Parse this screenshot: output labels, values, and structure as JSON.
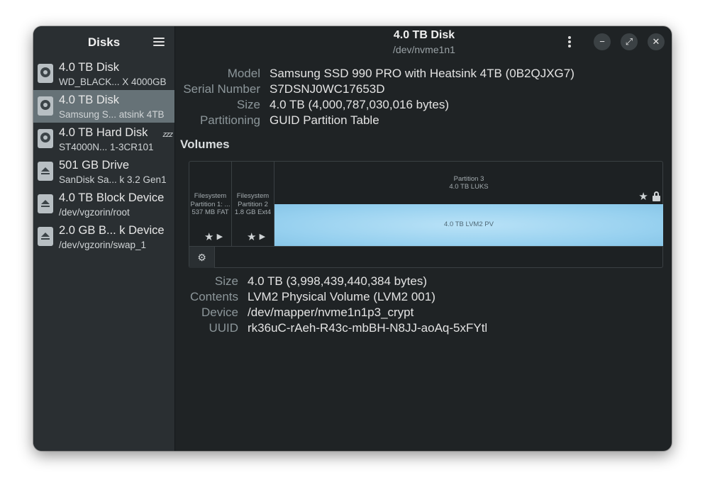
{
  "sidebar": {
    "title": "Disks",
    "items": [
      {
        "name": "4.0 TB Disk",
        "sub": "WD_BLACK... X 4000GB",
        "icon": "hard-disk-icon"
      },
      {
        "name": "4.0 TB Disk",
        "sub": "Samsung S... atsink 4TB",
        "icon": "hard-disk-icon",
        "selected": true
      },
      {
        "name": "4.0 TB Hard Disk",
        "sub": "ST4000N... 1-3CR101",
        "icon": "hard-disk-icon",
        "status": "zzz"
      },
      {
        "name": "501 GB Drive",
        "sub": "SanDisk Sa... k 3.2 Gen1",
        "icon": "removable-drive-icon"
      },
      {
        "name": "4.0 TB Block Device",
        "sub": "/dev/vgzorin/root",
        "icon": "removable-drive-icon"
      },
      {
        "name": "2.0 GB B... k Device",
        "sub": "/dev/vgzorin/swap_1",
        "icon": "removable-drive-icon"
      }
    ]
  },
  "header": {
    "title": "4.0 TB Disk",
    "subtitle": "/dev/nvme1n1",
    "minimize": "−",
    "maximize": "⤢",
    "close": "✕"
  },
  "drive": {
    "model_label": "Model",
    "model": "Samsung SSD 990 PRO with Heatsink 4TB (0B2QJXG7)",
    "serial_label": "Serial Number",
    "serial": "S7DSNJ0WC17653D",
    "size_label": "Size",
    "size": "4.0 TB (4,000,787,030,016 bytes)",
    "partitioning_label": "Partitioning",
    "partitioning": "GUID Partition Table"
  },
  "volumes": {
    "heading": "Volumes",
    "partitions": [
      {
        "line1": "Filesystem",
        "line2": "Partition 1: ...",
        "line3": "537 MB FAT"
      },
      {
        "line1": "Filesystem",
        "line2": "Partition 2",
        "line3": "1.8 GB Ext4"
      },
      {
        "line1": "Partition 3",
        "line2": "4.0 TB LUKS"
      }
    ],
    "lvm_label": "4.0 TB LVM2 PV",
    "icon_star": "★",
    "icon_play": "▶",
    "icon_gear": "⚙"
  },
  "selected_volume": {
    "size_label": "Size",
    "size": "4.0 TB (3,998,439,440,384 bytes)",
    "contents_label": "Contents",
    "contents": "LVM2 Physical Volume (LVM2 001)",
    "device_label": "Device",
    "device": "/dev/mapper/nvme1n1p3_crypt",
    "uuid_label": "UUID",
    "uuid": "rk36uC-rAeh-R43c-mbBH-N8JJ-aoAq-5xFYtl"
  },
  "colors": {
    "window_bg": "#1f2325",
    "sidebar_bg": "#2a2f32",
    "selected_bg": "#667277",
    "lvm_fill": "#a8daf3"
  }
}
